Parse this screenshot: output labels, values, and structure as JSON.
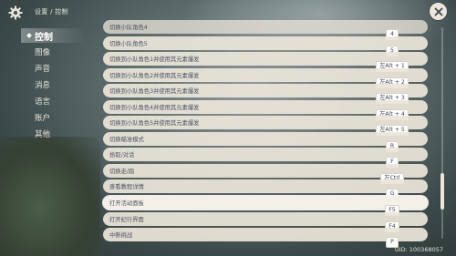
{
  "breadcrumb": "设置 / 控制",
  "sidebar": {
    "items": [
      {
        "label": "控制",
        "active": true
      },
      {
        "label": "图像"
      },
      {
        "label": "声音"
      },
      {
        "label": "消息"
      },
      {
        "label": "语言"
      },
      {
        "label": "账户"
      },
      {
        "label": "其他"
      }
    ]
  },
  "rows": [
    {
      "label": "切换小队角色4",
      "key": "4"
    },
    {
      "label": "切换小队角色5",
      "key": "5"
    },
    {
      "label": "切换到小队角色1并使用其元素爆发",
      "key": "左Alt + 1"
    },
    {
      "label": "切换到小队角色2并使用其元素爆发",
      "key": "左Alt + 2"
    },
    {
      "label": "切换到小队角色3并使用其元素爆发",
      "key": "左Alt + 3"
    },
    {
      "label": "切换到小队角色4并使用其元素爆发",
      "key": "左Alt + 4"
    },
    {
      "label": "切换到小队角色5并使用其元素爆发",
      "key": "左Alt + 5"
    },
    {
      "label": "切换瞄准模式",
      "key": "R"
    },
    {
      "label": "拾取/对话",
      "key": "F"
    },
    {
      "label": "切换走/跑",
      "key": "左Ctrl"
    },
    {
      "label": "查看教程详情",
      "key": "G"
    },
    {
      "label": "打开活动面板",
      "key": "F5"
    },
    {
      "label": "打开纪行界面",
      "key": "F4"
    },
    {
      "label": "中断挑战",
      "key": "P"
    }
  ],
  "uid": "UID: 100368057",
  "colors": {
    "panel": "#ece5d8",
    "text": "#495366"
  },
  "icons": {
    "settings": "gear-icon",
    "close": "close-icon"
  }
}
